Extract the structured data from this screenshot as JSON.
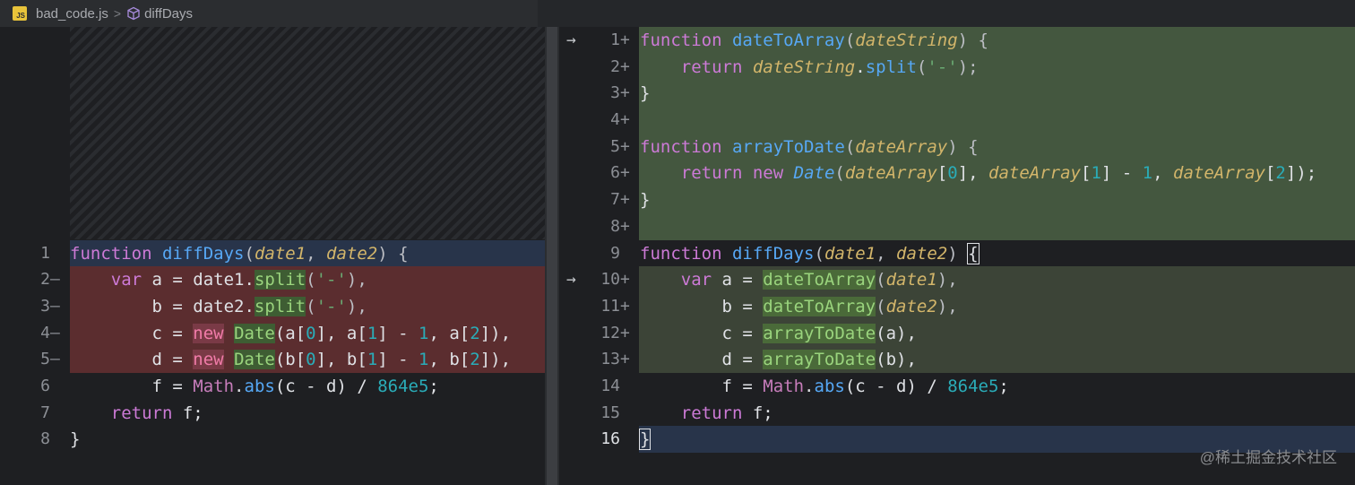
{
  "breadcrumb": {
    "file_badge": "JS",
    "file_name": "bad_code.js",
    "separator": ">",
    "function_name": "diffDays"
  },
  "left": {
    "lines": [
      {
        "num": "1",
        "mark": ""
      },
      {
        "num": "2",
        "mark": "—"
      },
      {
        "num": "3",
        "mark": "—"
      },
      {
        "num": "4",
        "mark": "—"
      },
      {
        "num": "5",
        "mark": "—"
      },
      {
        "num": "6",
        "mark": ""
      },
      {
        "num": "7",
        "mark": ""
      },
      {
        "num": "8",
        "mark": ""
      }
    ],
    "code": {
      "l1": {
        "kw": "function",
        "name": "diffDays",
        "open": "(",
        "p1": "date1",
        "comma": ", ",
        "p2": "date2",
        "close": ") {"
      },
      "l2": {
        "indent": "    ",
        "kw": "var",
        "t1": " a = date1.",
        "fn": "split",
        "t2": "(",
        "str": "'-'",
        "t3": "),"
      },
      "l3": {
        "indent": "        ",
        "t1": "b = date2.",
        "fn": "split",
        "t2": "(",
        "str": "'-'",
        "t3": "),"
      },
      "l4": {
        "indent": "        ",
        "t1": "c = ",
        "kw": "new",
        "t2": " ",
        "cls": "Date",
        "t3": "(a[",
        "n0": "0",
        "t4": "], a[",
        "n1": "1",
        "t5": "] - ",
        "n2": "1",
        "t6": ", a[",
        "n3": "2",
        "t7": "]),"
      },
      "l5": {
        "indent": "        ",
        "t1": "d = ",
        "kw": "new",
        "t2": " ",
        "cls": "Date",
        "t3": "(b[",
        "n0": "0",
        "t4": "], b[",
        "n1": "1",
        "t5": "] - ",
        "n2": "1",
        "t6": ", b[",
        "n3": "2",
        "t7": "]),"
      },
      "l6": {
        "indent": "        ",
        "t1": "f = ",
        "math": "Math",
        "t2": ".",
        "fn": "abs",
        "t3": "(c - d) / ",
        "num": "864e5",
        "t4": ";"
      },
      "l7": {
        "indent": "    ",
        "kw": "return",
        "t1": " f;"
      },
      "l8": {
        "t1": "}"
      }
    }
  },
  "right": {
    "lines": [
      {
        "num": "1",
        "mark": "+",
        "arrow": "→"
      },
      {
        "num": "2",
        "mark": "+",
        "arrow": ""
      },
      {
        "num": "3",
        "mark": "+",
        "arrow": ""
      },
      {
        "num": "4",
        "mark": "+",
        "arrow": ""
      },
      {
        "num": "5",
        "mark": "+",
        "arrow": ""
      },
      {
        "num": "6",
        "mark": "+",
        "arrow": ""
      },
      {
        "num": "7",
        "mark": "+",
        "arrow": ""
      },
      {
        "num": "8",
        "mark": "+",
        "arrow": ""
      },
      {
        "num": "9",
        "mark": "",
        "arrow": ""
      },
      {
        "num": "10",
        "mark": "+",
        "arrow": "→"
      },
      {
        "num": "11",
        "mark": "+",
        "arrow": ""
      },
      {
        "num": "12",
        "mark": "+",
        "arrow": ""
      },
      {
        "num": "13",
        "mark": "+",
        "arrow": ""
      },
      {
        "num": "14",
        "mark": "",
        "arrow": ""
      },
      {
        "num": "15",
        "mark": "",
        "arrow": ""
      },
      {
        "num": "16",
        "mark": "",
        "arrow": ""
      }
    ],
    "code": {
      "r1": {
        "kw": "function",
        "name": "dateToArray",
        "open": "(",
        "p1": "dateString",
        "close": ") {"
      },
      "r2": {
        "indent": "    ",
        "kw": "return",
        "t1": " ",
        "p1": "dateString",
        "t2": ".",
        "fn": "split",
        "t3": "(",
        "str": "'-'",
        "t4": ");"
      },
      "r3": {
        "t1": "}"
      },
      "r5": {
        "kw": "function",
        "name": "arrayToDate",
        "open": "(",
        "p1": "dateArray",
        "close": ") {"
      },
      "r6": {
        "indent": "    ",
        "kw": "return",
        "t1": " ",
        "kw2": "new",
        "t2": " ",
        "cls": "Date",
        "t3": "(",
        "p1": "dateArray",
        "t4": "[",
        "n0": "0",
        "t5": "], ",
        "p2": "dateArray",
        "t6": "[",
        "n1": "1",
        "t7": "] - ",
        "n2": "1",
        "t8": ", ",
        "p3": "dateArray",
        "t9": "[",
        "n3": "2",
        "t10": "]);"
      },
      "r7": {
        "t1": "}"
      },
      "r9": {
        "kw": "function",
        "name": "diffDays",
        "open": "(",
        "p1": "date1",
        "comma": ", ",
        "p2": "date2",
        "close": ") ",
        "brace": "{"
      },
      "r10": {
        "indent": "    ",
        "kw": "var",
        "t1": " a = ",
        "fn": "dateToArray",
        "t2": "(",
        "p1": "date1",
        "t3": "),"
      },
      "r11": {
        "indent": "        ",
        "t1": "b = ",
        "fn": "dateToArray",
        "t2": "(",
        "p1": "date2",
        "t3": "),"
      },
      "r12": {
        "indent": "        ",
        "t1": "c = ",
        "fn": "arrayToDate",
        "t2": "(a),"
      },
      "r13": {
        "indent": "        ",
        "t1": "d = ",
        "fn": "arrayToDate",
        "t2": "(b),"
      },
      "r14": {
        "indent": "        ",
        "t1": "f = ",
        "math": "Math",
        "t2": ".",
        "fn": "abs",
        "t3": "(c - d) / ",
        "num": "864e5",
        "t4": ";"
      },
      "r15": {
        "indent": "    ",
        "kw": "return",
        "t1": " f;"
      },
      "r16": {
        "brace": "}"
      }
    }
  },
  "watermark": "@稀土掘金技术社区",
  "colors": {
    "removed_bg": "#5b2d2f",
    "added_bg": "#44573f",
    "modified_bg": "#3c4437",
    "cursor_line_bg": "#28344a"
  }
}
